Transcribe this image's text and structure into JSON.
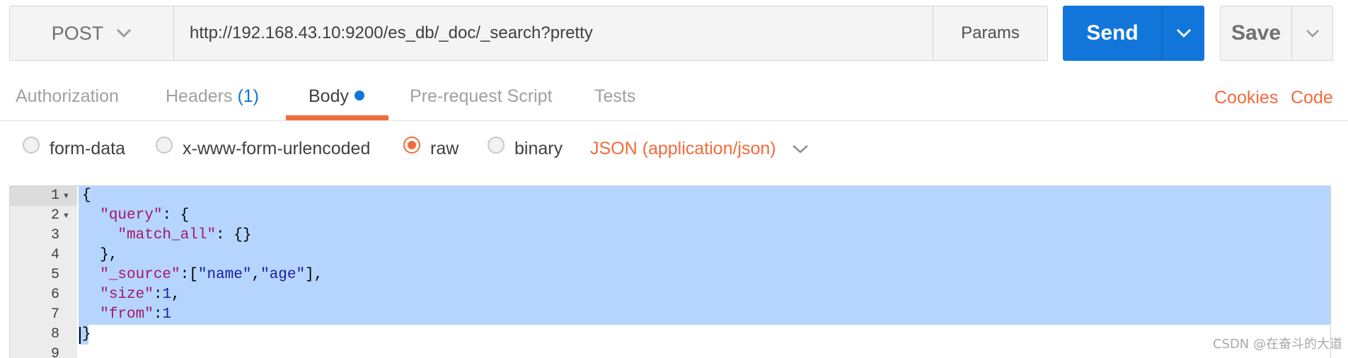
{
  "request": {
    "method": "POST",
    "url": "http://192.168.43.10:9200/es_db/_doc/_search?pretty",
    "params_label": "Params"
  },
  "actions": {
    "send_label": "Send",
    "save_label": "Save"
  },
  "tabs": [
    {
      "label": "Authorization"
    },
    {
      "label": "Headers",
      "count": "(1)"
    },
    {
      "label": "Body"
    },
    {
      "label": "Pre-request Script"
    },
    {
      "label": "Tests"
    }
  ],
  "links": {
    "cookies": "Cookies",
    "code": "Code"
  },
  "body_types": {
    "options": [
      {
        "label": "form-data",
        "selected": false
      },
      {
        "label": "x-www-form-urlencoded",
        "selected": false
      },
      {
        "label": "raw",
        "selected": true
      },
      {
        "label": "binary",
        "selected": false
      }
    ],
    "content_type": "JSON (application/json)"
  },
  "editor": {
    "line_numbers": [
      "1",
      "2",
      "3",
      "4",
      "5",
      "6",
      "7",
      "8",
      "9"
    ],
    "lines": [
      "{",
      "  \"query\": {",
      "    \"match_all\": {}",
      "  },",
      "  \"_source\":[\"name\",\"age\"],",
      "  \"size\":1,",
      "  \"from\":1",
      "}"
    ]
  },
  "colors": {
    "accent": "#f26b3a",
    "primary": "#1275d9",
    "selection": "#b5d5fe"
  },
  "watermark": "CSDN @在奋斗的大道"
}
